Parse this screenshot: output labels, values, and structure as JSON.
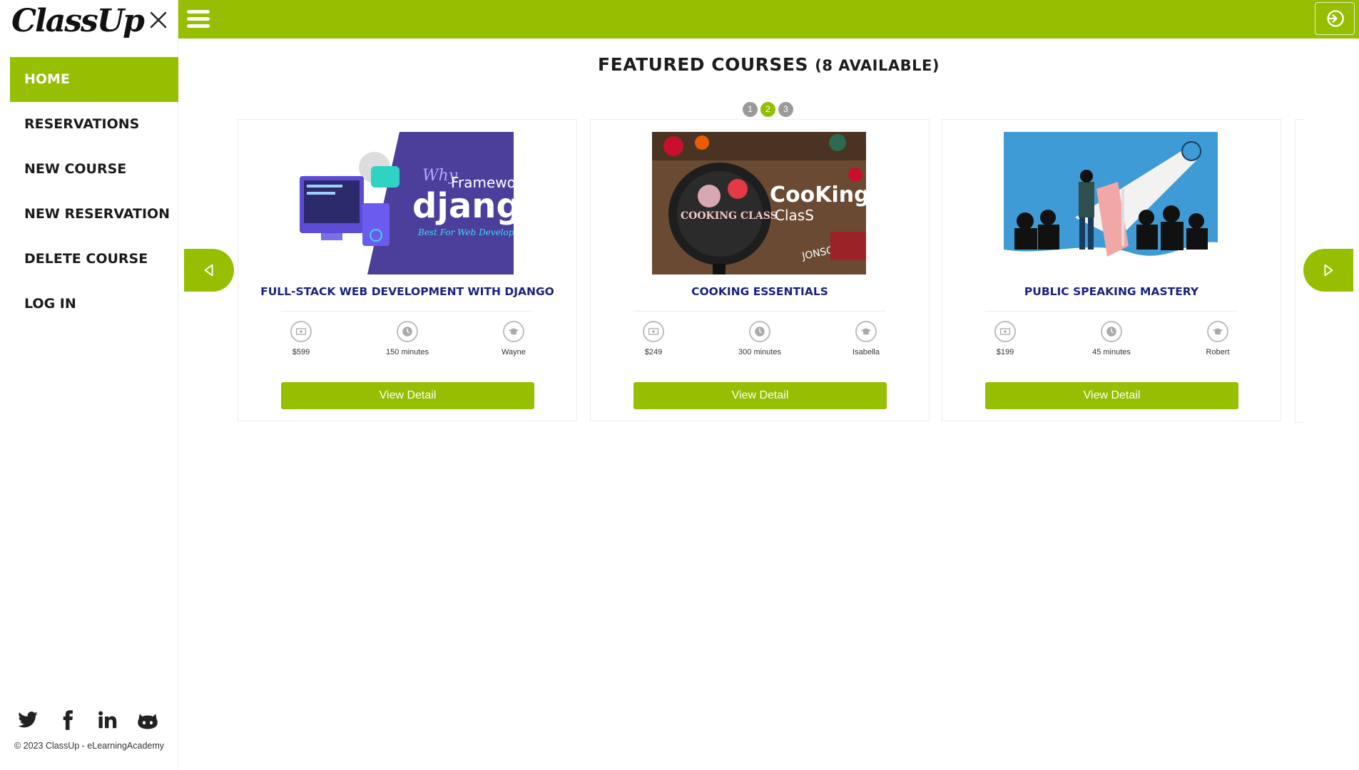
{
  "brand": {
    "logo_text": "ClassUp",
    "accent": "#95bf00"
  },
  "sidebar": {
    "items": [
      {
        "label": "HOME",
        "active": true
      },
      {
        "label": "RESERVATIONS"
      },
      {
        "label": "NEW COURSE"
      },
      {
        "label": "NEW RESERVATION"
      },
      {
        "label": "DELETE COURSE"
      },
      {
        "label": "LOG IN"
      }
    ],
    "socials": [
      "twitter-icon",
      "facebook-icon",
      "linkedin-icon",
      "github-icon"
    ],
    "copyright": "© 2023 ClassUp - eLearningAcademy"
  },
  "main": {
    "heading": "FEATURED COURSES",
    "heading_sub": "(8 AVAILABLE)",
    "pages": [
      "1",
      "2",
      "3"
    ],
    "active_page": "2",
    "courses": [
      {
        "title": "FULL-STACK WEB DEVELOPMENT WITH DJANGO",
        "price": "$599",
        "duration": "150 minutes",
        "instructor": "Wayne",
        "button": "View Detail",
        "image_text": {
          "why": "Why",
          "framework": "Framewo",
          "django": "djang",
          "tagline": "Best For Web Develop"
        }
      },
      {
        "title": "COOKING ESSENTIALS",
        "price": "$249",
        "duration": "300 minutes",
        "instructor": "Isabella",
        "button": "View Detail",
        "image_text": {
          "pan": "COOKING CLASS",
          "big": "CooKing",
          "small": "ClasS",
          "sign": "JONSON"
        }
      },
      {
        "title": "PUBLIC SPEAKING MASTERY",
        "price": "$199",
        "duration": "45 minutes",
        "instructor": "Robert",
        "button": "View Detail"
      }
    ]
  }
}
